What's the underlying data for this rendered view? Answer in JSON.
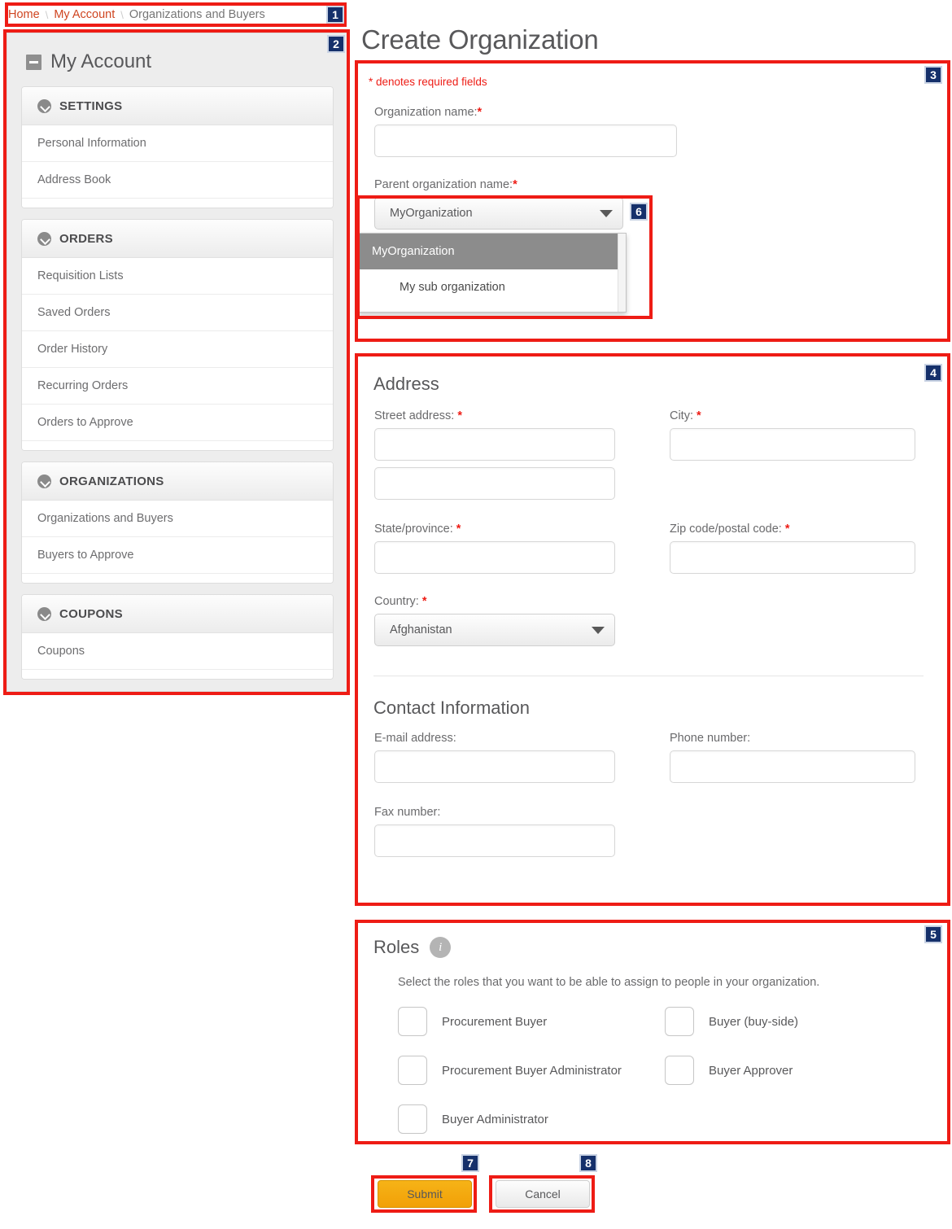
{
  "breadcrumb": {
    "items": [
      {
        "label": "Home",
        "current": false
      },
      {
        "label": "My Account",
        "current": false
      },
      {
        "label": "Organizations and Buyers",
        "current": true
      }
    ],
    "separator": "\\"
  },
  "sidebar": {
    "title": "My Account",
    "collapse_icon": "minus-icon",
    "groups": [
      {
        "title": "SETTINGS",
        "items": [
          "Personal Information",
          "Address Book"
        ]
      },
      {
        "title": "ORDERS",
        "items": [
          "Requisition Lists",
          "Saved Orders",
          "Order History",
          "Recurring Orders",
          "Orders to Approve"
        ]
      },
      {
        "title": "ORGANIZATIONS",
        "items": [
          "Organizations and Buyers",
          "Buyers to Approve"
        ]
      },
      {
        "title": "COUPONS",
        "items": [
          "Coupons"
        ]
      }
    ]
  },
  "main": {
    "page_title": "Create Organization",
    "required_note": "* denotes required fields",
    "org_form": {
      "org_name_label": "Organization name:",
      "org_name_value": "",
      "parent_org_label": "Parent organization name:",
      "parent_org_value": "MyOrganization",
      "parent_org_options": [
        {
          "label": "MyOrganization",
          "selected": true,
          "indent": false
        },
        {
          "label": "My sub organization",
          "selected": false,
          "indent": true
        }
      ]
    },
    "address": {
      "heading": "Address",
      "street_label": "Street address:",
      "street_value": "",
      "street2_value": "",
      "city_label": "City:",
      "city_value": "",
      "state_label": "State/province:",
      "state_value": "",
      "zip_label": "Zip code/postal code:",
      "zip_value": "",
      "country_label": "Country:",
      "country_value": "Afghanistan"
    },
    "contact": {
      "heading": "Contact Information",
      "email_label": "E-mail address:",
      "email_value": "",
      "phone_label": "Phone number:",
      "phone_value": "",
      "fax_label": "Fax number:",
      "fax_value": ""
    },
    "roles": {
      "heading": "Roles",
      "info_icon": "info-icon",
      "intro": "Select the roles that you want to be able to assign to people in your organization.",
      "rows": [
        [
          {
            "label": "Procurement Buyer",
            "checked": false
          },
          {
            "label": "Buyer (buy-side)",
            "checked": false
          }
        ],
        [
          {
            "label": "Procurement Buyer Administrator",
            "checked": false
          },
          {
            "label": "Buyer Approver",
            "checked": false
          }
        ],
        [
          {
            "label": "Buyer Administrator",
            "checked": false
          }
        ]
      ]
    },
    "actions": {
      "submit_label": "Submit",
      "cancel_label": "Cancel"
    }
  },
  "annotations": {
    "badges": [
      "1",
      "2",
      "3",
      "4",
      "5",
      "6",
      "7",
      "8"
    ]
  },
  "colors": {
    "annotation_red": "#ee1c15",
    "badge_navy": "#15306b",
    "breadcrumb_link": "#cf4520",
    "required_star": "#ee1c15",
    "submit_orange": "#f2a007",
    "sidebar_bg": "#ededed"
  }
}
